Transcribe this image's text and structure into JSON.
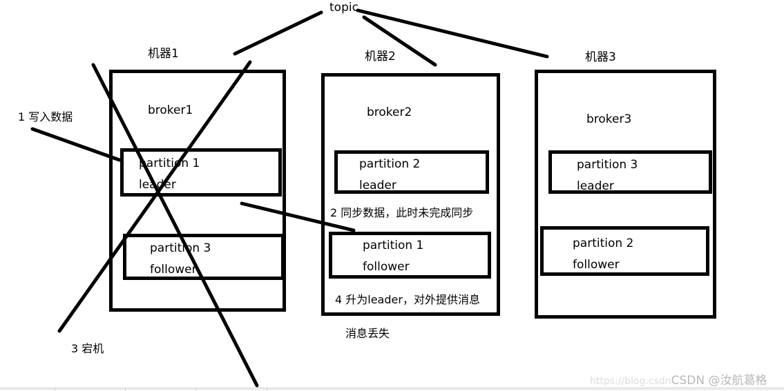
{
  "diagram": {
    "topic_label": "topic",
    "machines": [
      {
        "label": "机器1",
        "broker": "broker1",
        "crossed_out": true,
        "partitions": [
          {
            "name": "partition 1",
            "role": "leader"
          },
          {
            "name": "partition 3",
            "role": "follower"
          }
        ]
      },
      {
        "label": "机器2",
        "broker": "broker2",
        "crossed_out": false,
        "partitions": [
          {
            "name": "partition 2",
            "role": "leader"
          },
          {
            "name": "partition 1",
            "role": "follower"
          }
        ]
      },
      {
        "label": "机器3",
        "broker": "broker3",
        "crossed_out": false,
        "partitions": [
          {
            "name": "partition 3",
            "role": "leader"
          },
          {
            "name": "partition 2",
            "role": "follower"
          }
        ]
      }
    ],
    "annotations": {
      "step1": "1   写入数据",
      "step2": "2 同步数据，此时未完成同步",
      "step3": "3   宕机",
      "step4": "4 升为leader，对外提供消息",
      "result": "消息丢失"
    },
    "watermark": {
      "url": "https://blog.csdn",
      "brand": "CSDN @汝航葛格"
    }
  }
}
